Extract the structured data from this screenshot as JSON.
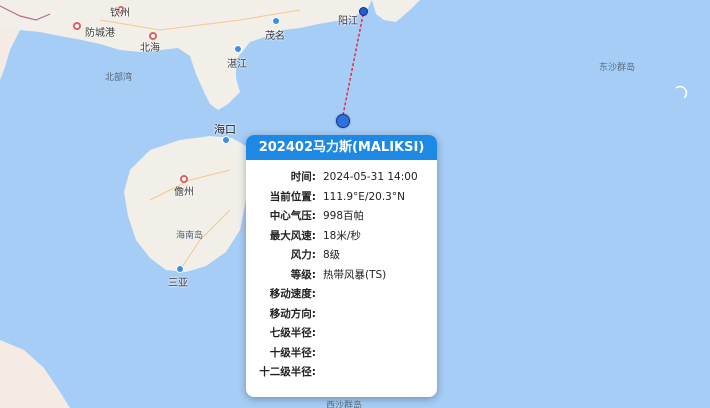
{
  "map": {
    "cities": {
      "qinzhou": "钦州",
      "fangchenggang": "防城港",
      "beihai": "北海",
      "maoming": "茂名",
      "zhanjiang": "湛江",
      "yangjiang": "阳江",
      "haikou": "海口",
      "danzhou": "儋州",
      "sanya": "三亚"
    },
    "regions": {
      "beibu_gulf": "北部湾",
      "hainan_island": "海南岛",
      "dongsha": "东沙群岛",
      "xisha": "西沙群岛"
    }
  },
  "typhoon": {
    "title": "202402马力斯(MALIKSI)",
    "fields": [
      {
        "key": "时间:",
        "value": "2024-05-31 14:00"
      },
      {
        "key": "当前位置:",
        "value": "111.9°E/20.3°N"
      },
      {
        "key": "中心气压:",
        "value": "998百帕"
      },
      {
        "key": "最大风速:",
        "value": "18米/秒"
      },
      {
        "key": "风力:",
        "value": "8级"
      },
      {
        "key": "等级:",
        "value": "热带风暴(TS)"
      },
      {
        "key": "移动速度:",
        "value": ""
      },
      {
        "key": "移动方向:",
        "value": ""
      },
      {
        "key": "七级半径:",
        "value": ""
      },
      {
        "key": "十级半径:",
        "value": ""
      },
      {
        "key": "十二级半径:",
        "value": ""
      }
    ]
  },
  "colors": {
    "sea": "#a6cdf5",
    "land": "#f2efe9",
    "popup_header": "#1e88e5",
    "track": "#e0243c"
  }
}
